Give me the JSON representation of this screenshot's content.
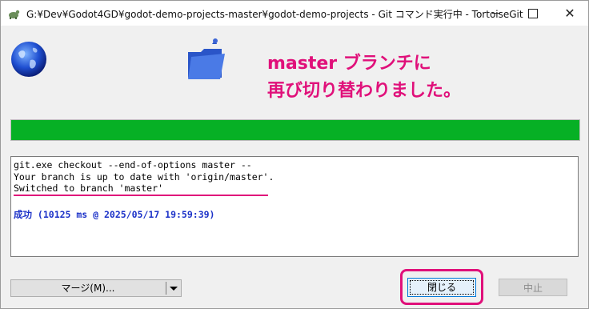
{
  "window": {
    "title": "G:¥Dev¥Godot4GD¥godot-demo-projects-master¥godot-demo-projects - Git コマンド実行中 - TortoiseGit",
    "icons": {
      "app": "tortoisegit-icon",
      "globe": "globe-icon",
      "folder": "folder-icon"
    }
  },
  "annotation": {
    "text": "master ブランチに\n再び切り替わりました。",
    "color": "#e0107a"
  },
  "progress": {
    "value": 100,
    "color": "#06b025"
  },
  "log": {
    "lines": [
      "git.exe checkout --end-of-options master --",
      "Your branch is up to date with 'origin/master'.",
      "Switched to branch 'master'"
    ],
    "result": "成功 (10125 ms @ 2025/05/17 19:59:39)"
  },
  "buttons": {
    "merge": "マージ(M)...",
    "close": "閉じる",
    "stop": "中止"
  }
}
